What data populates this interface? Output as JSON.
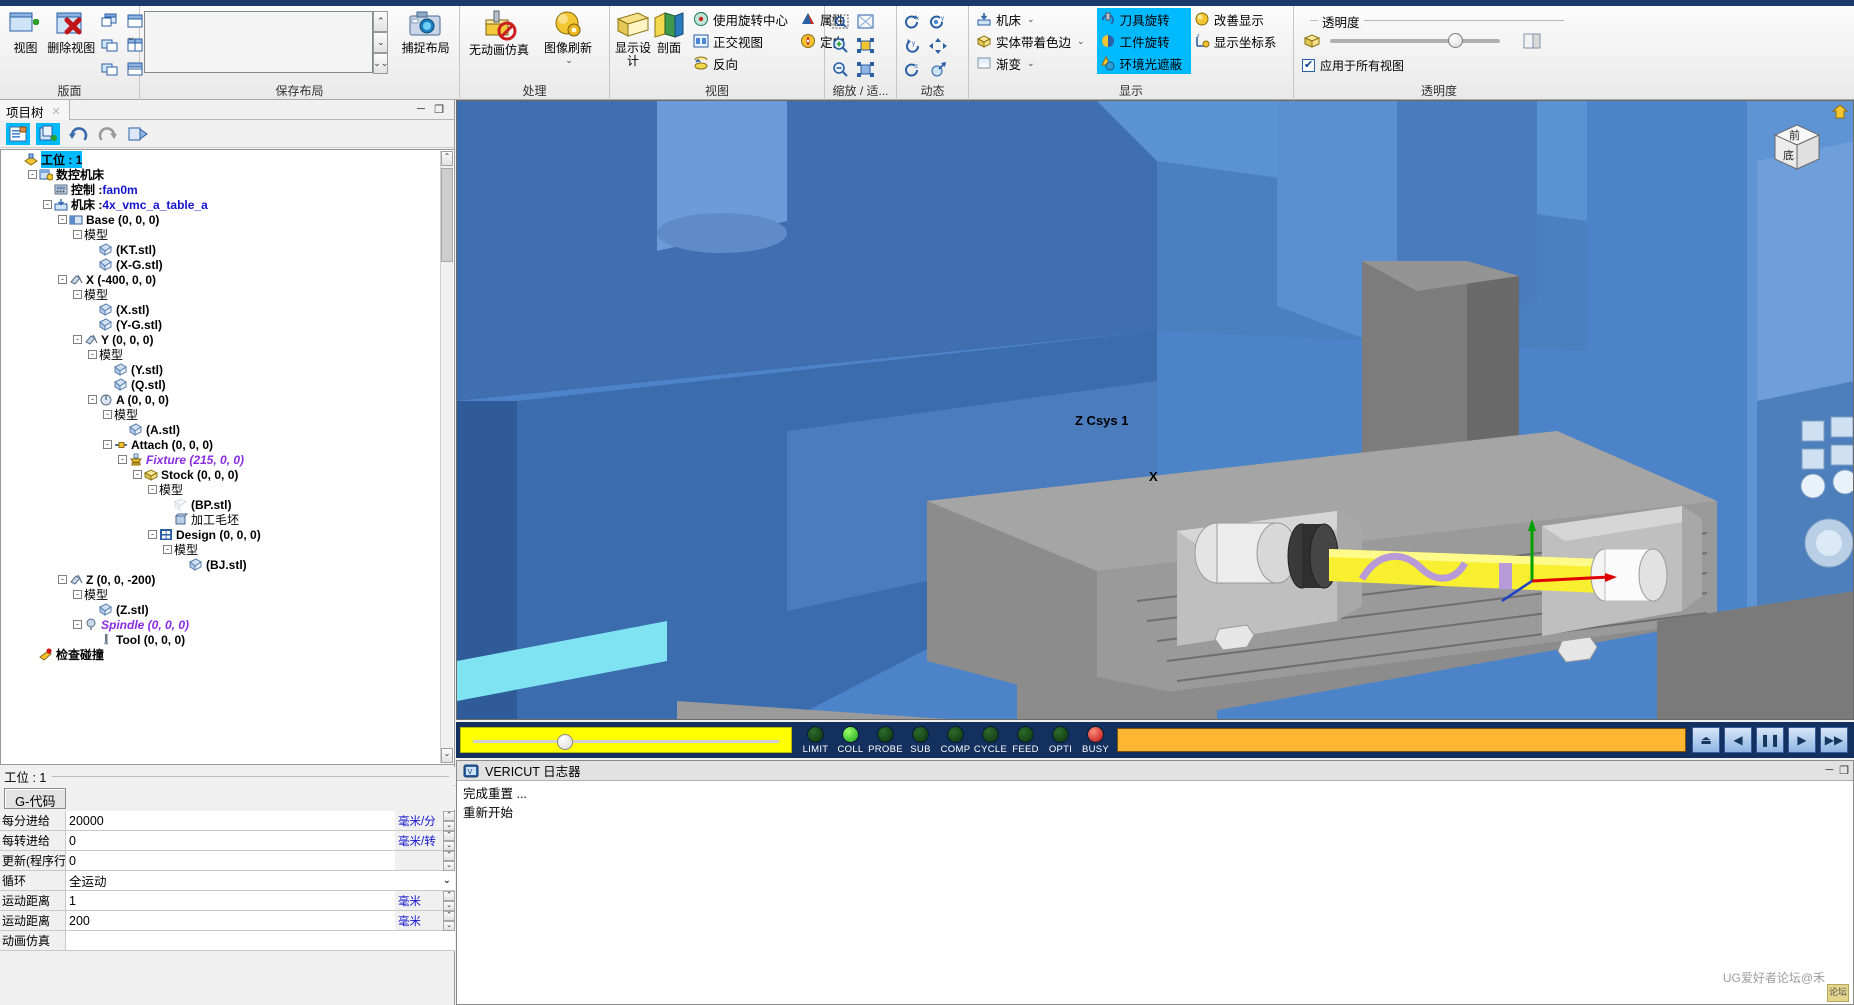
{
  "ribbon": {
    "groups": [
      {
        "label": "版面",
        "buttons": [
          {
            "label": "视图",
            "icon": "add-view-icon"
          },
          {
            "label": "删除视图",
            "icon": "delete-view-icon"
          }
        ],
        "icon_items": [
          {
            "name": "cascade-windows-icon"
          },
          {
            "name": "tile-windows-icon"
          },
          {
            "name": "arrange-windows-icon"
          },
          {
            "name": "single-pane-icon"
          },
          {
            "name": "two-pane-vertical-icon"
          },
          {
            "name": "two-pane-horizontal-icon"
          }
        ]
      },
      {
        "label": "保存布局",
        "listbox_value": "",
        "capture_label": "捕捉布局"
      },
      {
        "label": "处理",
        "buttons": [
          {
            "label": "无动画仿真",
            "icon": "no-animation-simulate-icon"
          },
          {
            "label": "图像刷新",
            "icon": "refresh-image-icon"
          }
        ]
      },
      {
        "label": "视图",
        "buttons": [
          {
            "label": "显示设计",
            "icon": "show-design-icon"
          },
          {
            "label": "剖面",
            "icon": "section-icon"
          }
        ],
        "small_items": [
          {
            "label": "使用旋转中心",
            "icon": "rotation-center-icon"
          },
          {
            "label": "正交视图",
            "icon": "orthographic-view-icon"
          },
          {
            "label": "反向",
            "icon": "reverse-icon"
          },
          {
            "label": "属性",
            "icon": "properties-icon"
          },
          {
            "label": "定向",
            "icon": "orient-icon"
          }
        ]
      },
      {
        "label": "缩放 / 适...",
        "icon_items": [
          {
            "name": "zoom-window-icon"
          },
          {
            "name": "fit-all-icon"
          },
          {
            "name": "zoom-in-icon"
          },
          {
            "name": "fit-selected-icon"
          },
          {
            "name": "zoom-out-icon"
          },
          {
            "name": "fit-stock-icon"
          }
        ]
      },
      {
        "label": "动态",
        "icon_items": [
          {
            "name": "rotate-x-icon"
          },
          {
            "name": "rotate-xy-icon"
          },
          {
            "name": "rotate-y-icon"
          },
          {
            "name": "pan-icon"
          },
          {
            "name": "rotate-z-icon"
          },
          {
            "name": "dynamic-rotate-icon"
          }
        ]
      },
      {
        "label": "显示",
        "dropdowns": [
          {
            "label": "机床",
            "icon": "machine-icon"
          },
          {
            "label": "实体带着色边",
            "icon": "shaded-solid-icon"
          },
          {
            "label": "渐变",
            "icon": "gradient-icon"
          }
        ],
        "toggles": [
          {
            "label": "刀具旋转",
            "icon": "tool-rotate-icon",
            "active": true
          },
          {
            "label": "工件旋转",
            "icon": "workpiece-rotate-icon",
            "active": true
          },
          {
            "label": "环境光遮蔽",
            "icon": "ambient-occlusion-icon",
            "active": true
          }
        ],
        "items": [
          {
            "label": "改善显示",
            "icon": "improve-display-icon"
          },
          {
            "label": "显示坐标系",
            "icon": "show-csys-icon"
          }
        ]
      },
      {
        "label": "透明度",
        "fieldset_label": "透明度",
        "slider_value": 70,
        "checkbox_label": "应用于所有视图",
        "checkbox_checked": true,
        "box_icon": "transparency-box-icon",
        "panel_icon": "transparency-panel-icon"
      }
    ]
  },
  "left_panel": {
    "tab_label": "项目树",
    "toolbar": [
      {
        "name": "configure-icon",
        "active": true
      },
      {
        "name": "add-component-icon",
        "active": true
      },
      {
        "name": "undo-icon",
        "active": false
      },
      {
        "name": "redo-icon",
        "active": false
      },
      {
        "name": "export-icon",
        "active": false
      }
    ],
    "tree": [
      {
        "indent": 0,
        "label": "工位 : 1",
        "style": "sel",
        "icon": "setup-icon",
        "expander": ""
      },
      {
        "indent": 1,
        "label": "数控机床",
        "style": "plain",
        "icon": "cnc-machine-icon",
        "expander": "-"
      },
      {
        "indent": 2,
        "label": "控制 : ",
        "value": "fan0m",
        "style": "plain",
        "icon": "control-icon",
        "expander": ""
      },
      {
        "indent": 2,
        "label": "机床 : ",
        "value": "4x_vmc_a_table_a",
        "style": "plain",
        "icon": "machine-node-icon",
        "expander": "-"
      },
      {
        "indent": 3,
        "label": "Base (0, 0, 0)",
        "style": "plain",
        "icon": "base-icon",
        "expander": "-"
      },
      {
        "indent": 4,
        "label": "模型",
        "style": "normal",
        "icon": "",
        "expander": "-"
      },
      {
        "indent": 5,
        "label": "(KT.stl)",
        "style": "plain",
        "icon": "stl-icon",
        "expander": ""
      },
      {
        "indent": 5,
        "label": "(X-G.stl)",
        "style": "plain",
        "icon": "stl-icon",
        "expander": ""
      },
      {
        "indent": 3,
        "label": "X (-400, 0, 0)",
        "style": "plain",
        "icon": "axis-icon",
        "expander": "-"
      },
      {
        "indent": 4,
        "label": "模型",
        "style": "normal",
        "icon": "",
        "expander": "-"
      },
      {
        "indent": 5,
        "label": "(X.stl)",
        "style": "plain",
        "icon": "stl-icon",
        "expander": ""
      },
      {
        "indent": 5,
        "label": "(Y-G.stl)",
        "style": "plain",
        "icon": "stl-icon",
        "expander": ""
      },
      {
        "indent": 4,
        "label": "Y (0, 0, 0)",
        "style": "plain",
        "icon": "axis-icon",
        "expander": "-"
      },
      {
        "indent": 5,
        "label": "模型",
        "style": "normal",
        "icon": "",
        "expander": "-"
      },
      {
        "indent": 6,
        "label": "(Y.stl)",
        "style": "plain",
        "icon": "stl-icon",
        "expander": ""
      },
      {
        "indent": 6,
        "label": "(Q.stl)",
        "style": "plain",
        "icon": "stl-icon",
        "expander": ""
      },
      {
        "indent": 5,
        "label": "A (0, 0, 0)",
        "style": "plain",
        "icon": "rotary-axis-icon",
        "expander": "-"
      },
      {
        "indent": 6,
        "label": "模型",
        "style": "normal",
        "icon": "",
        "expander": "-"
      },
      {
        "indent": 7,
        "label": "(A.stl)",
        "style": "plain",
        "icon": "stl-icon",
        "expander": ""
      },
      {
        "indent": 6,
        "label": "Attach (0, 0, 0)",
        "style": "plain",
        "icon": "attach-icon",
        "expander": "-"
      },
      {
        "indent": 7,
        "label": "Fixture (215, 0, 0)",
        "style": "magenta",
        "icon": "fixture-icon",
        "expander": "-"
      },
      {
        "indent": 8,
        "label": "Stock (0, 0, 0)",
        "style": "plain",
        "icon": "stock-icon",
        "expander": "-"
      },
      {
        "indent": 9,
        "label": "模型",
        "style": "normal",
        "icon": "",
        "expander": "-"
      },
      {
        "indent": 10,
        "label": "(BP.stl)",
        "style": "plain",
        "icon": "stl-ghost-icon",
        "expander": ""
      },
      {
        "indent": 10,
        "label": "加工毛坯",
        "style": "normal",
        "icon": "machined-stock-icon",
        "expander": ""
      },
      {
        "indent": 9,
        "label": "Design (0, 0, 0)",
        "style": "plain",
        "icon": "design-icon",
        "expander": "-"
      },
      {
        "indent": 10,
        "label": "模型",
        "style": "normal",
        "icon": "",
        "expander": "-"
      },
      {
        "indent": 11,
        "label": "(BJ.stl)",
        "style": "plain",
        "icon": "stl-icon",
        "expander": ""
      },
      {
        "indent": 3,
        "label": "Z (0, 0, -200)",
        "style": "plain",
        "icon": "axis-icon",
        "expander": "-"
      },
      {
        "indent": 4,
        "label": "模型",
        "style": "normal",
        "icon": "",
        "expander": "-"
      },
      {
        "indent": 5,
        "label": "(Z.stl)",
        "style": "plain",
        "icon": "stl-icon",
        "expander": ""
      },
      {
        "indent": 4,
        "label": "Spindle (0, 0, 0)",
        "style": "magenta",
        "icon": "spindle-icon",
        "expander": "-"
      },
      {
        "indent": 5,
        "label": "Tool (0, 0, 0)",
        "style": "plain",
        "icon": "tool-icon",
        "expander": ""
      },
      {
        "indent": 1,
        "label": "检查碰撞",
        "style": "plain",
        "icon": "collision-check-icon",
        "expander": ""
      }
    ],
    "status_line": "工位 : 1",
    "gcode_tab": "G-代码",
    "form_rows": [
      {
        "caption": "每分进给",
        "value": "20000",
        "unit": "毫米/分",
        "type": "spin"
      },
      {
        "caption": "每转进给",
        "value": "0",
        "unit": "毫米/转",
        "type": "spin"
      },
      {
        "caption": "更新(程序行数)",
        "value": "0",
        "unit": "",
        "type": "spin"
      },
      {
        "caption": "循环",
        "value": "全运动",
        "unit": "",
        "type": "select"
      },
      {
        "caption": "运动距离",
        "value": "1",
        "unit": "毫米",
        "type": "spin"
      },
      {
        "caption": "运动距离",
        "value": "200",
        "unit": "毫米",
        "type": "spin"
      },
      {
        "caption": "动画仿真",
        "value": "",
        "unit": "",
        "type": "plain"
      }
    ]
  },
  "view3d": {
    "csys_label": "Z Csys 1",
    "axis_x_label": "X",
    "view_cube_top": "前",
    "view_cube_bottom": "底"
  },
  "playbar": {
    "lamps": [
      {
        "label": "LIMIT",
        "state": "off"
      },
      {
        "label": "COLL",
        "state": "on"
      },
      {
        "label": "PROBE",
        "state": "off"
      },
      {
        "label": "SUB",
        "state": "off"
      },
      {
        "label": "COMP",
        "state": "off"
      },
      {
        "label": "CYCLE",
        "state": "off"
      },
      {
        "label": "FEED",
        "state": "off"
      },
      {
        "label": "OPTI",
        "state": "off"
      },
      {
        "label": "BUSY",
        "state": "alarm"
      }
    ],
    "transport": [
      {
        "name": "reset-button",
        "glyph": "⏏"
      },
      {
        "name": "step-back-button",
        "glyph": "◀"
      },
      {
        "name": "pause-button",
        "glyph": "❚❚"
      },
      {
        "name": "play-button",
        "glyph": "▶"
      },
      {
        "name": "fast-forward-button",
        "glyph": "▶▶"
      }
    ]
  },
  "log": {
    "title": "VERICUT 日志器",
    "icon": "log-icon",
    "lines": [
      "完成重置 ...",
      "重新开始"
    ],
    "watermark": "UG爱好者论坛@禾"
  }
}
